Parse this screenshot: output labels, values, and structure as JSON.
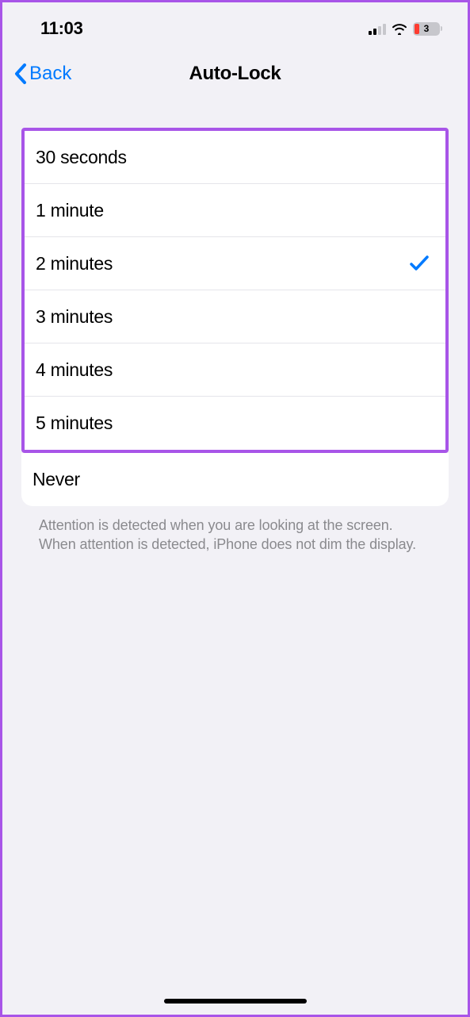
{
  "status": {
    "time": "11:03",
    "battery_pct": "3"
  },
  "nav": {
    "back_label": "Back",
    "title": "Auto-Lock"
  },
  "options": [
    {
      "label": "30 seconds",
      "selected": false
    },
    {
      "label": "1 minute",
      "selected": false
    },
    {
      "label": "2 minutes",
      "selected": true
    },
    {
      "label": "3 minutes",
      "selected": false
    },
    {
      "label": "4 minutes",
      "selected": false
    },
    {
      "label": "5 minutes",
      "selected": false
    }
  ],
  "never_option": {
    "label": "Never",
    "selected": false
  },
  "footer": "Attention is detected when you are looking at the screen. When attention is detected, iPhone does not dim the display."
}
